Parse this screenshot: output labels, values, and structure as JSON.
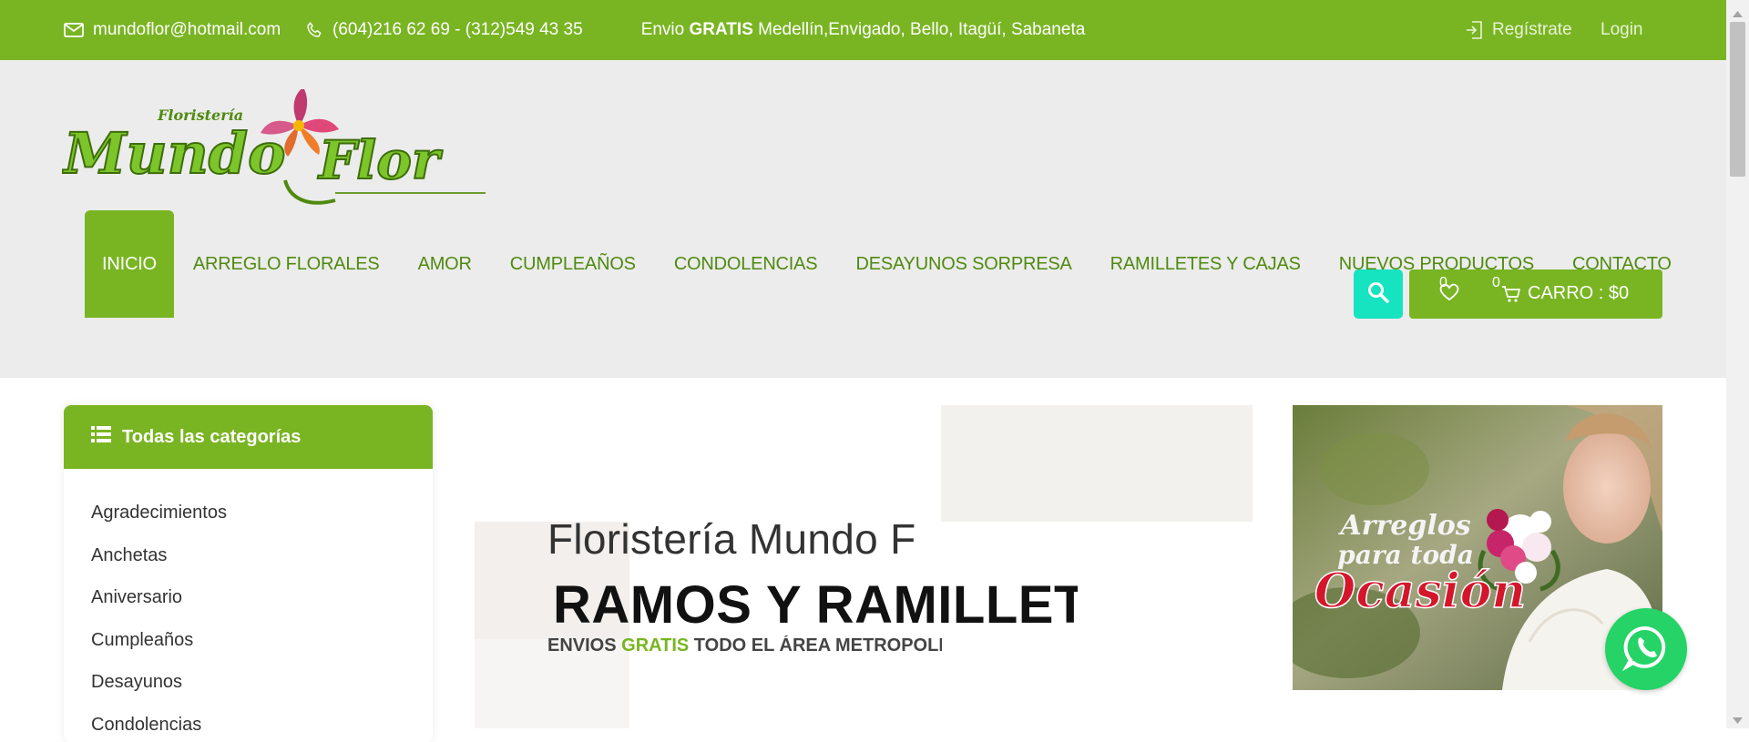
{
  "topbar": {
    "email": "mundoflor@hotmail.com",
    "phone": "(604)216 62 69 - (312)549 43 35",
    "shipping_prefix": "Envio",
    "shipping_bold": "GRATIS",
    "shipping_rest": "Medellín,Envigado, Bello, Itagüí, Sabaneta",
    "register": "Regístrate",
    "login": "Login"
  },
  "logo": {
    "small_text": "Floristería",
    "text_left": "Mundo",
    "text_right": "Flor"
  },
  "nav": {
    "items": [
      {
        "label": "INICIO",
        "active": true
      },
      {
        "label": "ARREGLO FLORALES"
      },
      {
        "label": "AMOR"
      },
      {
        "label": "CUMPLEAÑOS"
      },
      {
        "label": "CONDOLENCIAS"
      },
      {
        "label": "DESAYUNOS SORPRESA"
      },
      {
        "label": "RAMILLETES Y CAJAS"
      },
      {
        "label": "NUEVOS PRODUCTOS"
      },
      {
        "label": "CONTACTO"
      }
    ]
  },
  "cart": {
    "wishlist_count": "0",
    "cart_count": "0",
    "label": "CARRO : $0"
  },
  "categories": {
    "title": "Todas las categorías",
    "items": [
      "Agradecimientos",
      "Anchetas",
      "Aniversario",
      "Cumpleaños",
      "Desayunos",
      "Condolencias"
    ]
  },
  "slider": {
    "subtitle": "Floristería Mundo Flor",
    "title": "RAMOS Y RAMILLETES",
    "tag_prefix": "ENVIOS",
    "tag_green": "GRATIS",
    "tag_rest": "TODO EL ÁREA METROPOLITANA"
  },
  "promo": {
    "line1": "Arreglos",
    "line2": "para toda",
    "line3": "Ocasión"
  },
  "colors": {
    "brand_green": "#79b522",
    "nav_text_green": "#4f8a0f",
    "search_teal": "#16e3c0",
    "whatsapp_green": "#25d366",
    "promo_red": "#d4162c"
  },
  "icons": [
    "mail-icon",
    "phone-icon",
    "register-icon",
    "search-icon",
    "heart-icon",
    "cart-icon",
    "menu-icon",
    "whatsapp-icon"
  ]
}
